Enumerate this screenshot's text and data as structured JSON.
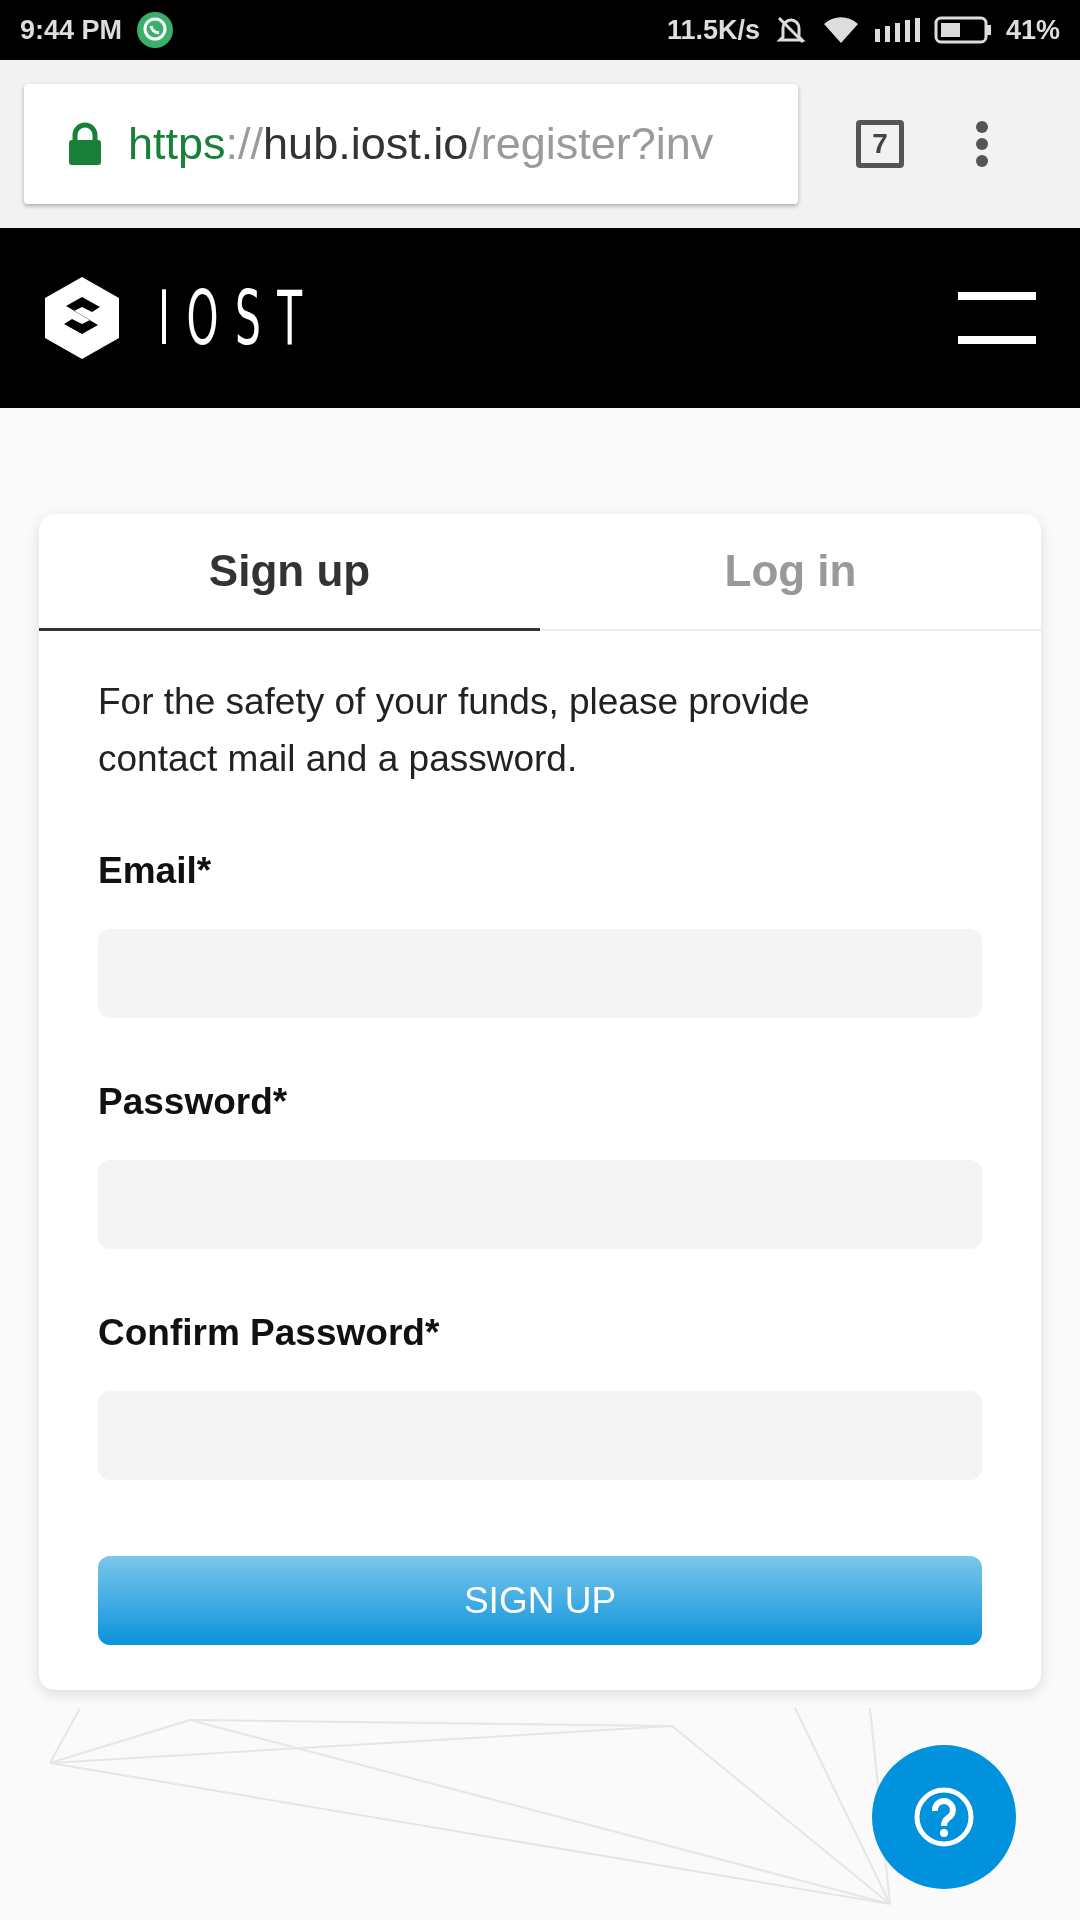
{
  "status_bar": {
    "time": "9:44 PM",
    "net_speed": "11.5K/s",
    "battery": "41%"
  },
  "browser": {
    "url": {
      "scheme": "https",
      "separator": "://",
      "host": "hub.iost.io",
      "path": "/register?inv"
    },
    "tab_count": "7"
  },
  "header": {
    "logo_text": "IOST"
  },
  "tabs": [
    {
      "label": "Sign up",
      "selected": true
    },
    {
      "label": "Log in",
      "selected": false
    }
  ],
  "intro": "For the safety of your funds, please provide contact mail and a password.",
  "fields": [
    {
      "label": "Email*"
    },
    {
      "label": "Password*"
    },
    {
      "label": "Confirm Password*"
    }
  ],
  "submit": "SIGN UP"
}
